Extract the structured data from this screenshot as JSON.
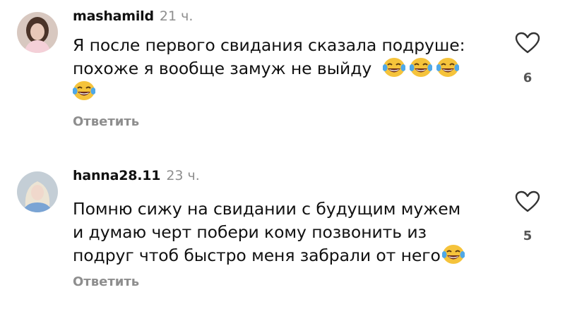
{
  "comments": [
    {
      "username": "mashamild",
      "time": "21 ч.",
      "line1": "Я после первого свидания сказала подруше:",
      "line2": "похоже я вообще замуж не выйду",
      "reply": "Ответить",
      "likes": "6",
      "emoji_icon": "face-with-tears-of-joy-icon"
    },
    {
      "username": "hanna28.11",
      "time": "23 ч.",
      "line1": "Помню сижу на свидании с будущим мужем",
      "line2": "и думаю черт побери кому позвонить из",
      "line3": "подруг чтоб быстро меня забрали от него",
      "reply": "Ответить",
      "likes": "5",
      "emoji_icon": "face-with-tears-of-joy-icon"
    }
  ],
  "colors": {
    "text": "#111111",
    "muted": "#8e8e8e",
    "background": "#ffffff"
  }
}
